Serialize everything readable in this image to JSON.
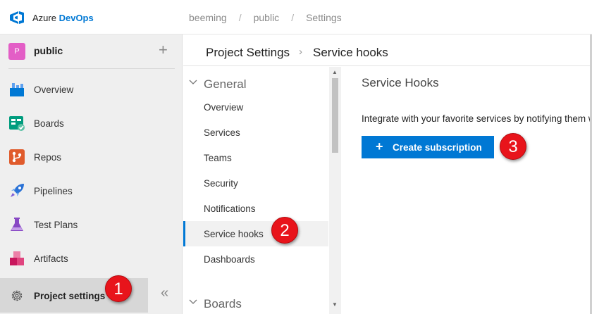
{
  "brand": {
    "prefix": "Azure",
    "name": "DevOps"
  },
  "breadcrumb": [
    "beeming",
    "public",
    "Settings"
  ],
  "breadcrumb_separator": "/",
  "project": {
    "initial": "P",
    "name": "public",
    "add_icon": "plus-icon",
    "color": "#e35ec6"
  },
  "nav": [
    {
      "label": "Overview",
      "icon": "overview-icon"
    },
    {
      "label": "Boards",
      "icon": "boards-icon"
    },
    {
      "label": "Repos",
      "icon": "repos-icon"
    },
    {
      "label": "Pipelines",
      "icon": "pipelines-icon"
    },
    {
      "label": "Test Plans",
      "icon": "test-plans-icon"
    },
    {
      "label": "Artifacts",
      "icon": "artifacts-icon"
    }
  ],
  "settings": {
    "label": "Project settings",
    "icon": "gear-icon",
    "collapse_glyph": "«"
  },
  "page_header": {
    "title": "Project Settings",
    "chevron": "›",
    "subtitle": "Service hooks"
  },
  "settings_nav": {
    "groups": [
      {
        "label": "General",
        "items": [
          "Overview",
          "Services",
          "Teams",
          "Security",
          "Notifications",
          "Service hooks",
          "Dashboards"
        ]
      },
      {
        "label": "Boards",
        "items": []
      }
    ],
    "active_item": "Service hooks"
  },
  "main": {
    "heading": "Service Hooks",
    "description": "Integrate with your favorite services by notifying them when events happen in your project.",
    "button_icon": "+",
    "button_label": "Create subscription"
  },
  "callouts": [
    "1",
    "2",
    "3"
  ],
  "colors": {
    "accent": "#0078d4",
    "callout": "#e8141b"
  }
}
